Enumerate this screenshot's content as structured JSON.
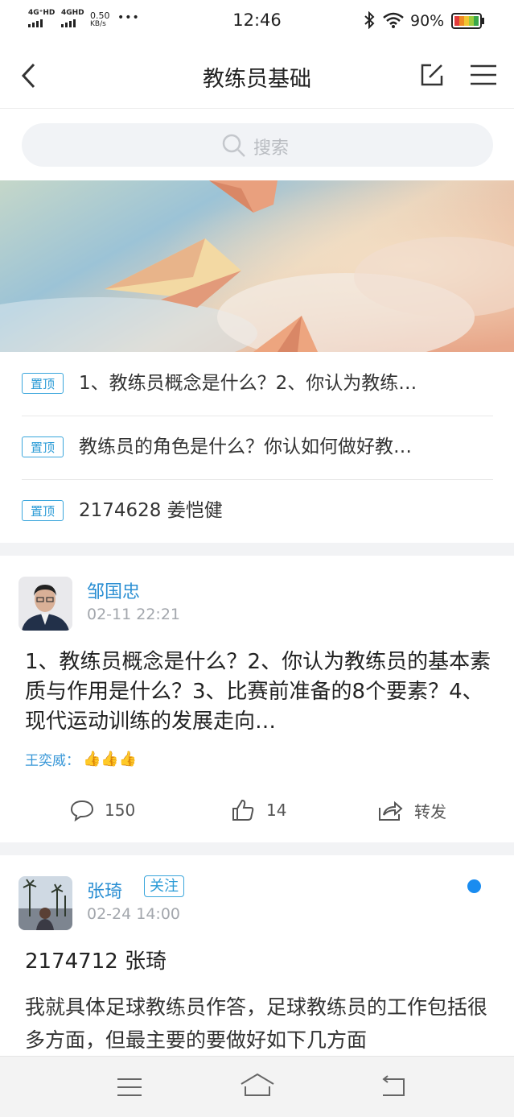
{
  "status_bar": {
    "sim1": "4G⁺HD",
    "sim2": "4GHD",
    "net_speed_value": "0.50",
    "net_speed_unit": "KB/s",
    "more": "•••",
    "time": "12:46",
    "battery": "90%"
  },
  "nav": {
    "title": "教练员基础"
  },
  "search": {
    "placeholder": "搜索"
  },
  "pinned": [
    {
      "badge": "置顶",
      "text": "1、教练员概念是什么？2、你认为教练…"
    },
    {
      "badge": "置顶",
      "text": "教练员的角色是什么？你认如何做好教…"
    },
    {
      "badge": "置顶",
      "text": "2174628 姜恺健"
    }
  ],
  "posts": [
    {
      "author": "邹国忠",
      "date": "02-11 22:21",
      "title": "1、教练员概念是什么？2、你认为教练员的基本素质与作用是什么？3、比赛前准备的8个要素？4、现代运动训练的发展走向…",
      "likes_label": "王奕威：",
      "likes_icons": "👍👍👍",
      "comments": "150",
      "like_count": "14",
      "share_label": "转发"
    },
    {
      "author": "张琦",
      "follow_label": "关注",
      "date": "02-24 14:00",
      "title": "2174712 张琦",
      "body": "我就具体足球教练员作答，足球教练员的工作包括很多方面，但最主要的要做好如下几方面"
    }
  ],
  "colors": {
    "accent": "#2b8fd3",
    "unread_dot": "#1a8cf0"
  }
}
